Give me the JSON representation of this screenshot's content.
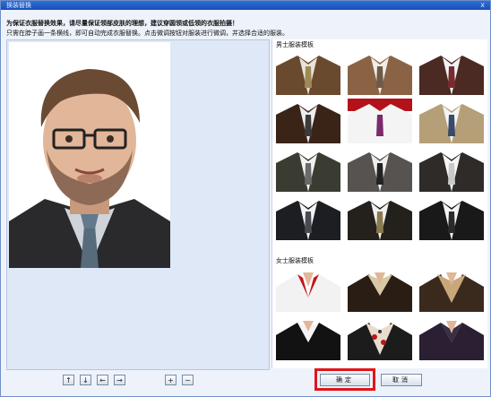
{
  "window": {
    "title": "换装替换",
    "close_label": "x"
  },
  "hints": {
    "line1": "为保证衣服替换效果，请尽量保证领部皮肤的理想，建议穿圆领或低领的衣服拍摄！",
    "line2": "只需在脖子画一条横线，即可自动完成衣服替换。点击微调按钮对服装进行微调，并选择合适的服装。"
  },
  "library": {
    "men_label": "男士服装模板",
    "women_label": "女士服装模板"
  },
  "nav": {
    "up": "↑",
    "down": "↓",
    "left": "←",
    "right": "→",
    "plus": "+",
    "minus": "−"
  },
  "buttons": {
    "ok": "确定",
    "cancel": "取消"
  },
  "colors": {
    "highlight": "#e0151a",
    "titlebar": "#2f6fd8"
  }
}
